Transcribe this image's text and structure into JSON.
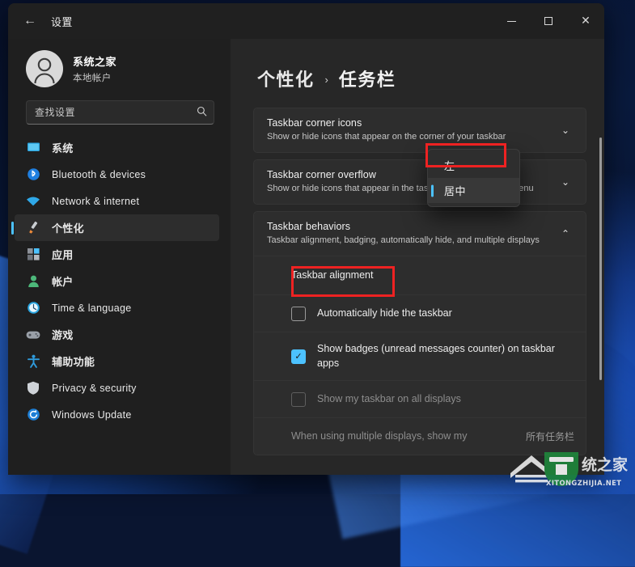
{
  "window": {
    "title": "设置",
    "back_icon": "←",
    "controls": {
      "minimize": "minimize",
      "maximize": "maximize",
      "close": "✕"
    }
  },
  "sidebar": {
    "account": {
      "name": "系统之家",
      "type": "本地帐户",
      "avatar_icon": "person-icon"
    },
    "search": {
      "placeholder": "查找设置",
      "icon": "search-icon"
    },
    "items": [
      {
        "label": "系统",
        "icon": "display-icon",
        "cjk": true,
        "selected": false
      },
      {
        "label": "Bluetooth & devices",
        "icon": "bluetooth-icon",
        "cjk": false,
        "selected": false
      },
      {
        "label": "Network & internet",
        "icon": "wifi-icon",
        "cjk": false,
        "selected": false
      },
      {
        "label": "个性化",
        "icon": "brush-icon",
        "cjk": true,
        "selected": true
      },
      {
        "label": "应用",
        "icon": "apps-icon",
        "cjk": true,
        "selected": false
      },
      {
        "label": "帐户",
        "icon": "account-icon",
        "cjk": true,
        "selected": false
      },
      {
        "label": "Time & language",
        "icon": "clock-icon",
        "cjk": false,
        "selected": false
      },
      {
        "label": "游戏",
        "icon": "gamepad-icon",
        "cjk": true,
        "selected": false
      },
      {
        "label": "辅助功能",
        "icon": "accessibility-icon",
        "cjk": true,
        "selected": false
      },
      {
        "label": "Privacy & security",
        "icon": "shield-icon",
        "cjk": false,
        "selected": false
      },
      {
        "label": "Windows Update",
        "icon": "update-icon",
        "cjk": false,
        "selected": false
      }
    ]
  },
  "main": {
    "breadcrumb": {
      "parent": "个性化",
      "separator": "›",
      "current": "任务栏"
    },
    "cards": [
      {
        "title": "Taskbar corner icons",
        "subtitle": "Show or hide icons that appear on the corner of your taskbar",
        "chevron": "⌄"
      },
      {
        "title": "Taskbar corner overflow",
        "subtitle": "Show or hide icons that appear in the taskbar corner overflow menu",
        "chevron": "⌄"
      },
      {
        "title": "Taskbar behaviors",
        "subtitle": "Taskbar alignment, badging, automatically hide, and multiple displays",
        "chevron": "⌃"
      }
    ],
    "behaviors": {
      "alignment_label": "Taskbar alignment",
      "auto_hide_label": "Automatically hide the taskbar",
      "auto_hide_checked": false,
      "badges_label": "Show badges (unread messages counter) on taskbar apps",
      "badges_checked": true,
      "all_displays_label": "Show my taskbar on all displays",
      "all_displays_checked": false,
      "all_displays_disabled": true,
      "multiple_displays_label": "When using multiple displays, show my",
      "multiple_displays_value": "所有任务栏"
    },
    "dropdown": {
      "options": [
        {
          "label": "左",
          "active": false
        },
        {
          "label": "居中",
          "active": true
        }
      ]
    }
  },
  "watermark": {
    "text": "XITONGZHIJIA.NET"
  }
}
